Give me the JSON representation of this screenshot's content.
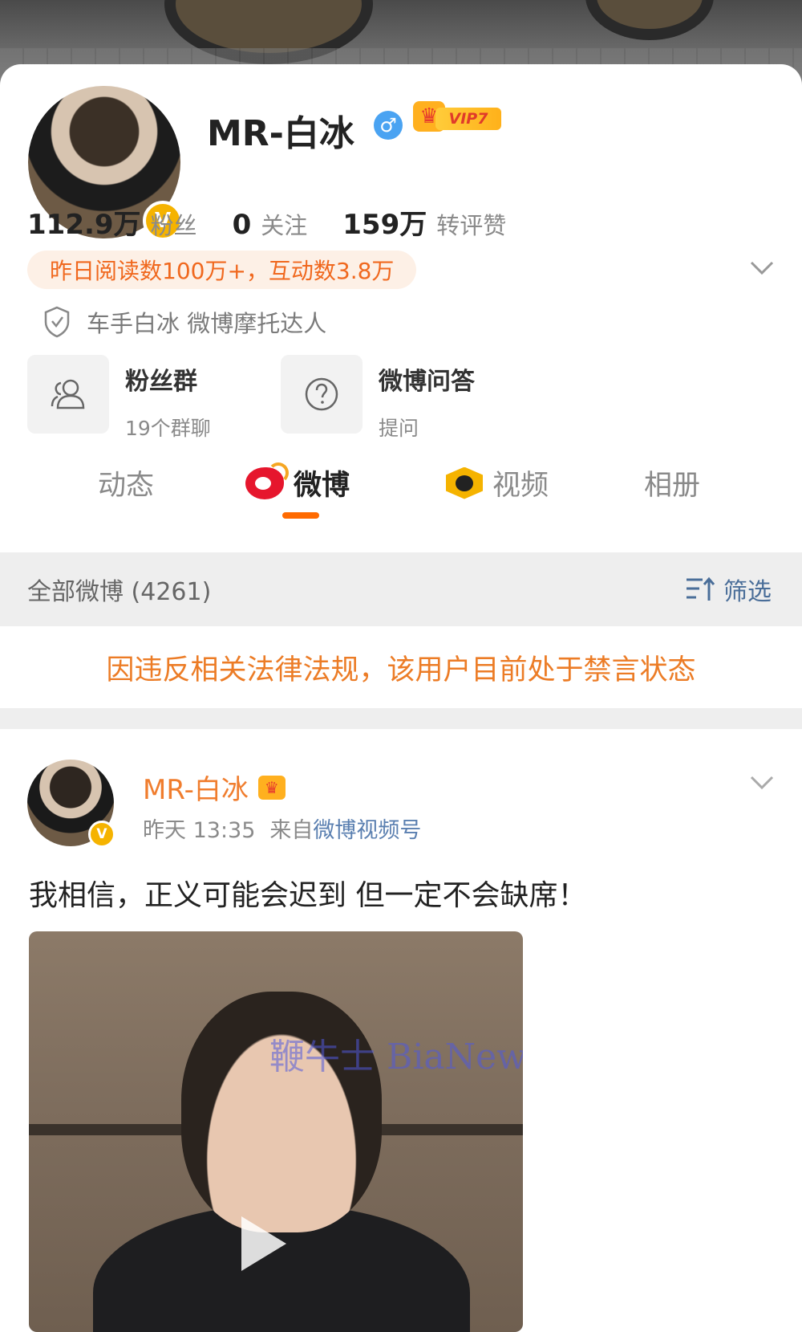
{
  "profile": {
    "name": "MR-白冰",
    "vip_label": "VIP7",
    "stats": [
      {
        "num": "112.9万",
        "label": "粉丝"
      },
      {
        "num": "0",
        "label": "关注"
      },
      {
        "num": "159万",
        "label": "转评赞"
      }
    ],
    "reads_text": "昨日阅读数100万+，互动数3.8万",
    "certification": "车手白冰 微博摩托达人"
  },
  "features": [
    {
      "title": "粉丝群",
      "subtitle": "19个群聊",
      "icon": "users-icon"
    },
    {
      "title": "微博问答",
      "subtitle": "提问",
      "icon": "question-icon"
    }
  ],
  "tabs": [
    {
      "label": "动态"
    },
    {
      "label": "微博",
      "active": true,
      "icon": "weibo-logo-icon"
    },
    {
      "label": "视频",
      "icon": "video-logo-icon"
    },
    {
      "label": "相册"
    }
  ],
  "filter_bar": {
    "count_text": "全部微博 (4261)",
    "filter_label": "筛选"
  },
  "notice": "因违反相关法律法规，该用户目前处于禁言状态",
  "post": {
    "author": "MR-白冰",
    "time": "昨天 13:35",
    "source_prefix": "来自",
    "source": "微博视频号",
    "text": "我相信，正义可能会迟到 但一定不会缺席！",
    "video_watermark": "鞭牛士 BiaNews"
  },
  "colors": {
    "accent_orange": "#ff6a00",
    "notice_orange": "#ec7c26",
    "link_blue": "#5a7fb0",
    "verified_gold": "#f5b300"
  }
}
